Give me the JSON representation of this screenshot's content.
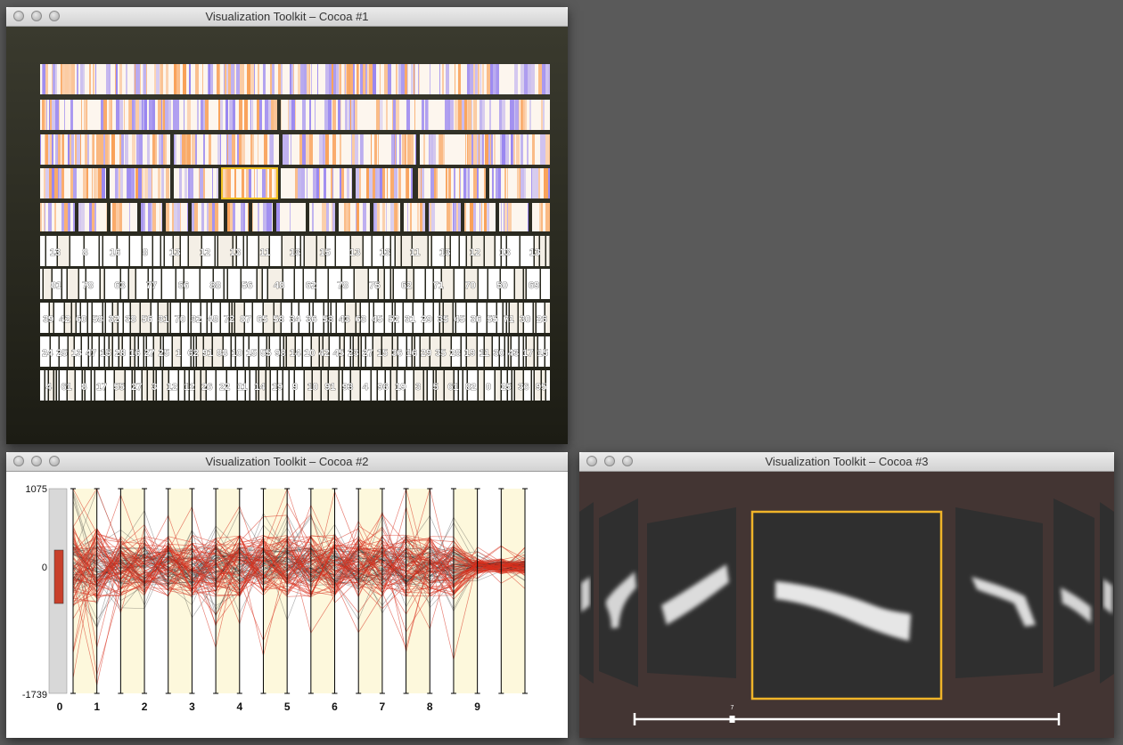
{
  "windows": [
    {
      "title": "Visualization Toolkit – Cocoa #1"
    },
    {
      "title": "Visualization Toolkit – Cocoa #2"
    },
    {
      "title": "Visualization Toolkit – Cocoa #3"
    }
  ],
  "treemap": {
    "row_labels": [
      [
        "13",
        "8",
        "16",
        "8",
        "13",
        "12",
        "13",
        "11",
        "13",
        "15",
        "13",
        "13",
        "11",
        "13",
        "12",
        "13",
        "13"
      ],
      [
        "81",
        "78",
        "63",
        "77",
        "66",
        "88",
        "56",
        "48",
        "62",
        "78",
        "75",
        "62",
        "71",
        "70",
        "50",
        "69"
      ],
      [
        "39",
        "42",
        "60",
        "58",
        "32",
        "38",
        "56",
        "31",
        "70",
        "32",
        "48",
        "72",
        "87",
        "65",
        "58",
        "34",
        "36",
        "53",
        "43",
        "63",
        "45",
        "52",
        "31",
        "29",
        "35",
        "45",
        "36",
        "55",
        "71",
        "30",
        "26"
      ],
      [
        "24",
        "25",
        "13",
        "47",
        "15",
        "28",
        "16",
        "27",
        "25",
        "1",
        "62",
        "91",
        "88",
        "10",
        "15",
        "55",
        "98",
        "14",
        "10",
        "42",
        "45",
        "23",
        "27",
        "15",
        "36",
        "16",
        "29",
        "35",
        "28",
        "19",
        "11",
        "30",
        "43",
        "17",
        "15"
      ],
      [
        "4",
        "61",
        "8",
        "17",
        "55",
        "27",
        "3",
        "12",
        "12",
        "26",
        "22",
        "11",
        "14",
        "19",
        "9",
        "10",
        "91",
        "93",
        "4",
        "96",
        "19",
        "3",
        "5",
        "61",
        "82",
        "0",
        "25",
        "36",
        "95"
      ]
    ]
  },
  "pcoords": {
    "y_max_label": "1075",
    "y_zero_label": "0",
    "y_min_label": "-1739",
    "x_labels": [
      "0",
      "1",
      "2",
      "3",
      "4",
      "5",
      "6",
      "7",
      "8",
      "9"
    ],
    "accent_color": "#d9311e",
    "selection_color": "#c8402b"
  },
  "gallery": {
    "slider_label": "7",
    "slider_value": 0.23,
    "highlight_color": "#f0b429"
  }
}
